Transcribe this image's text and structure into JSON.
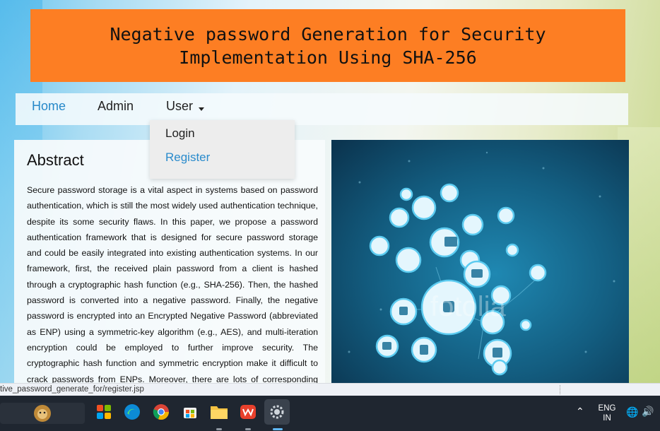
{
  "banner": {
    "title_line1": "Negative password Generation for Security",
    "title_line2": "Implementation Using SHA-256"
  },
  "nav": {
    "home": "Home",
    "admin": "Admin",
    "user": "User"
  },
  "user_menu": {
    "items": [
      "Login",
      "Register"
    ]
  },
  "abstract": {
    "title": "Abstract",
    "body": "Secure password storage is a vital aspect in systems based on password authentication, which is still the most widely used authentication technique, despite its some security flaws. In this paper, we propose a password authentication framework that is designed for secure password storage and could be easily integrated into existing authentication systems. In our framework, first, the received plain password from a client is hashed through a cryptographic hash function (e.g., SHA-256). Then, the hashed password is converted into a negative password. Finally, the negative password is encrypted into an Encrypted Negative Password (abbreviated as ENP) using a symmetric-key algorithm (e.g., AES), and multi-iteration encryption could be employed to further improve security. The cryptographic hash function and symmetric encryption make it difficult to crack passwords from ENPs. Moreover, there are lots of corresponding ENPs for a given plain password."
  },
  "hero_image": {
    "watermark": "fotolia"
  },
  "status_bar": {
    "url": "tive_password_generate_for/register.jsp"
  },
  "taskbar": {
    "apps": [
      "widgets-icon",
      "copilot-icon",
      "edge-icon",
      "chrome-icon",
      "store-icon",
      "file-explorer-icon",
      "wps-office-icon",
      "settings-icon"
    ],
    "language_line1": "ENG",
    "language_line2": "IN"
  },
  "colors": {
    "banner": "#fd7e23",
    "link": "#2689c9",
    "hero_bg": "#0f4a66"
  }
}
